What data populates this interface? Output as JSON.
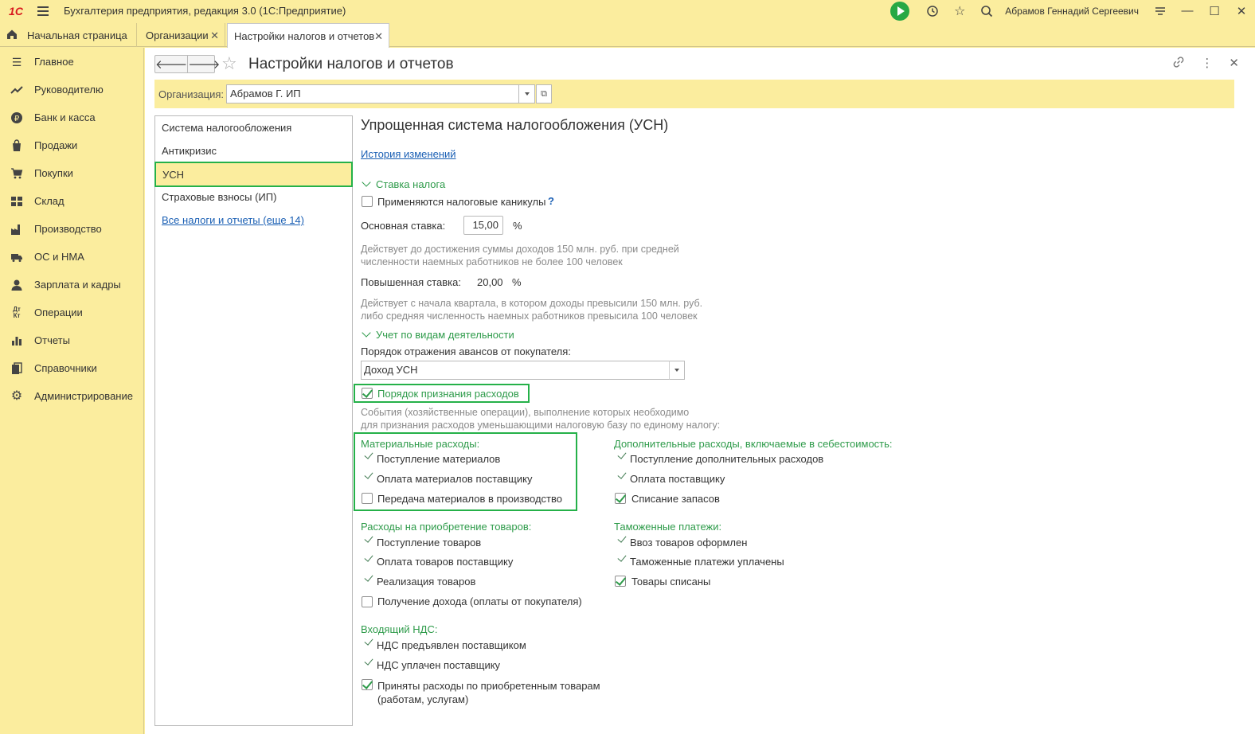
{
  "app": {
    "logo": "1С",
    "title": "Бухгалтерия предприятия, редакция 3.0  (1С:Предприятие)",
    "user": "Абрамов Геннадий Сергеевич"
  },
  "tabs": [
    {
      "label": "Начальная страница"
    },
    {
      "label": "Организации"
    },
    {
      "label": "Настройки налогов и отчетов"
    }
  ],
  "sidebar": {
    "items": [
      {
        "label": "Главное",
        "icon": "menu-lines-icon"
      },
      {
        "label": "Руководителю",
        "icon": "trend-icon"
      },
      {
        "label": "Банк и касса",
        "icon": "ruble-icon"
      },
      {
        "label": "Продажи",
        "icon": "bag-icon"
      },
      {
        "label": "Покупки",
        "icon": "cart-icon"
      },
      {
        "label": "Склад",
        "icon": "warehouse-icon"
      },
      {
        "label": "Производство",
        "icon": "factory-icon"
      },
      {
        "label": "ОС и НМА",
        "icon": "truck-icon"
      },
      {
        "label": "Зарплата и кадры",
        "icon": "person-icon"
      },
      {
        "label": "Операции",
        "icon": "dt-kt-icon"
      },
      {
        "label": "Отчеты",
        "icon": "bar-chart-icon"
      },
      {
        "label": "Справочники",
        "icon": "books-icon"
      },
      {
        "label": "Администрирование",
        "icon": "gear-icon"
      }
    ]
  },
  "header": {
    "title": "Настройки налогов и отчетов",
    "org_label": "Организация:",
    "org_value": "Абрамов Г. ИП"
  },
  "leftnav": {
    "items": [
      "Система налогообложения",
      "Антикризис",
      "УСН",
      "Страховые взносы (ИП)"
    ],
    "selected": "УСН",
    "all_link": "Все налоги и отчеты (еще 14)"
  },
  "content": {
    "heading": "Упрощенная система налогообложения (УСН)",
    "history_link": "История изменений",
    "group_rate": "Ставка налога",
    "tax_holidays": "Применяются налоговые каникулы",
    "tax_holidays_help": "?",
    "base_rate_label": "Основная ставка:",
    "base_rate_value": "15,00",
    "percent": "%",
    "note1_line1": "Действует до достижения суммы доходов 150 млн. руб. при средней",
    "note1_line2": "численности наемных работников не более 100 человек",
    "increased_rate_label": "Повышенная ставка:",
    "increased_rate_value": "20,00",
    "note2_line1": "Действует с начала квартала, в котором доходы превысили 150 млн. руб.",
    "note2_line2": "либо средняя численность наемных работников превысила 100 человек",
    "group_activity": "Учет по видам деятельности",
    "advances_label": "Порядок отражения авансов от покупателя:",
    "advances_value": "Доход УСН",
    "expense_order": "Порядок признания расходов",
    "events_line1": "События (хозяйственные операции), выполнение которых необходимо",
    "events_line2": "для признания расходов уменьшающими налоговую базу по единому налогу:",
    "material": {
      "title": "Материальные расходы:",
      "items": [
        {
          "label": "Поступление материалов",
          "state": "tick"
        },
        {
          "label": "Оплата материалов поставщику",
          "state": "tick"
        },
        {
          "label": "Передача материалов в производство",
          "state": "unchecked"
        }
      ]
    },
    "additional": {
      "title": "Дополнительные расходы, включаемые в себестоимость:",
      "items": [
        {
          "label": "Поступление дополнительных расходов",
          "state": "tick"
        },
        {
          "label": "Оплата поставщику",
          "state": "tick"
        },
        {
          "label": "Списание запасов",
          "state": "checked"
        }
      ]
    },
    "goods": {
      "title": "Расходы на приобретение товаров:",
      "items": [
        {
          "label": "Поступление товаров",
          "state": "tick"
        },
        {
          "label": "Оплата товаров поставщику",
          "state": "tick"
        },
        {
          "label": "Реализация товаров",
          "state": "tick"
        },
        {
          "label": "Получение дохода (оплаты от покупателя)",
          "state": "unchecked"
        }
      ]
    },
    "customs": {
      "title": "Таможенные платежи:",
      "items": [
        {
          "label": "Ввоз товаров оформлен",
          "state": "tick"
        },
        {
          "label": "Таможенные платежи уплачены",
          "state": "tick"
        },
        {
          "label": "Товары списаны",
          "state": "checked"
        }
      ]
    },
    "vat": {
      "title": "Входящий НДС:",
      "items": [
        {
          "label": "НДС предъявлен поставщиком",
          "state": "tick"
        },
        {
          "label": "НДС уплачен поставщику",
          "state": "tick"
        },
        {
          "label": "Приняты расходы по приобретенным товарам",
          "state": "checked"
        }
      ],
      "last_line2": "(работам, услугам)"
    }
  },
  "colors": {
    "accent_yellow": "#fbed9e",
    "highlight_green": "#25b149",
    "group_green": "#2e9b4a",
    "link_blue": "#1a5fb4"
  }
}
